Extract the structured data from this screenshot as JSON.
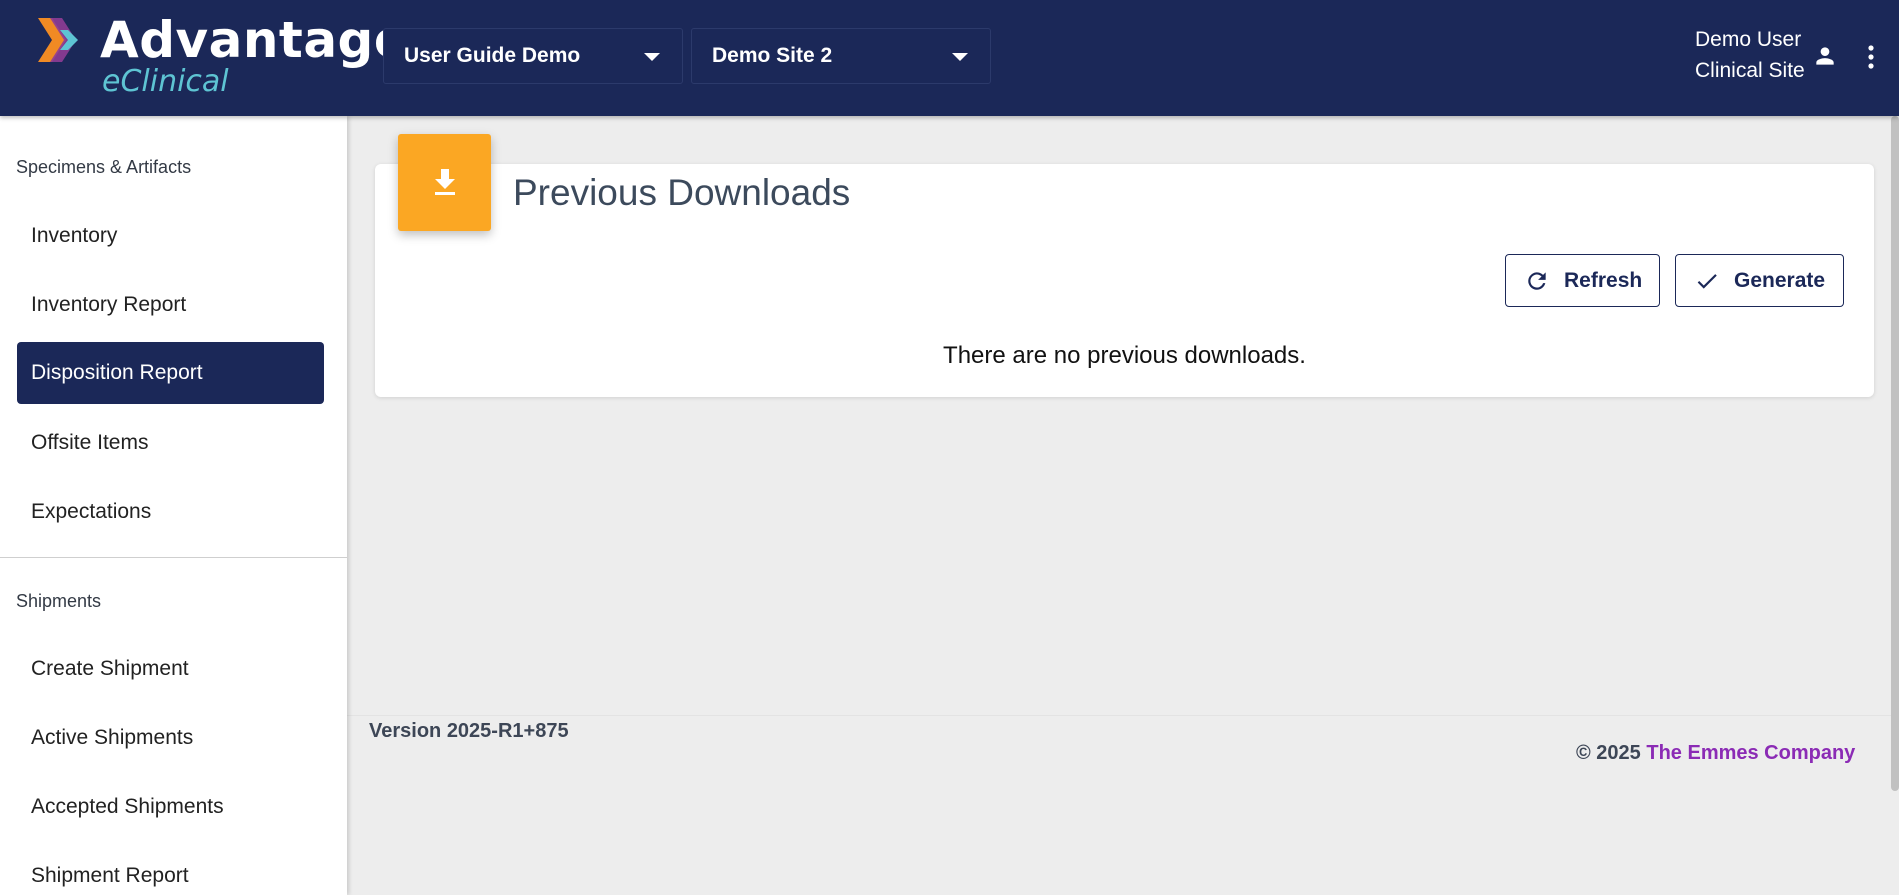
{
  "header": {
    "logo_word": "Advantage",
    "logo_sub": "eClinical",
    "study_selector": "User Guide Demo",
    "site_selector": "Demo Site 2",
    "user_name": "Demo User",
    "user_role": "Clinical Site",
    "icons": [
      "person-icon",
      "more-vert-icon",
      "caret-down-icon"
    ]
  },
  "sidebar": {
    "sections": [
      {
        "label": "Specimens & Artifacts",
        "items": [
          {
            "label": "Inventory"
          },
          {
            "label": "Inventory Report"
          },
          {
            "label": "Disposition Report",
            "active": true
          },
          {
            "label": "Offsite Items"
          },
          {
            "label": "Expectations"
          }
        ]
      },
      {
        "label": "Shipments",
        "items": [
          {
            "label": "Create Shipment"
          },
          {
            "label": "Active Shipments"
          },
          {
            "label": "Accepted Shipments"
          },
          {
            "label": "Shipment Report"
          }
        ]
      }
    ]
  },
  "main": {
    "title": "Previous Downloads",
    "refresh_label": "Refresh",
    "generate_label": "Generate",
    "empty_message": "There are no previous downloads."
  },
  "footer": {
    "version": "Version 2025-R1+875",
    "copyright_prefix": "© 2025",
    "company": "The Emmes Company"
  },
  "colors": {
    "header_bg": "#1b2858",
    "accent_orange": "#fba723",
    "logo_sub": "#5ec4d3",
    "company_link": "#8b2bb5",
    "page_bg": "#ededed"
  }
}
